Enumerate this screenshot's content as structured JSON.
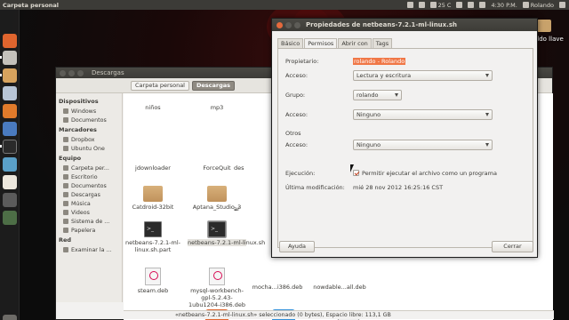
{
  "top_panel": {
    "window_title": "Carpeta personal",
    "temperature": "25 C",
    "clock": "4:30 P.M.",
    "user": "Rolando"
  },
  "desktop": {
    "folder_label": "aldo llave"
  },
  "file_manager": {
    "title": "Descargas",
    "path_buttons": [
      "Carpeta personal",
      "Descargas"
    ],
    "sidebar": {
      "devices_header": "Dispositivos",
      "devices": [
        "Windows",
        "Documentos"
      ],
      "bookmarks_header": "Marcadores",
      "bookmarks": [
        "Dropbox",
        "Ubuntu One"
      ],
      "computer_header": "Equipo",
      "computer": [
        "Carpeta per...",
        "Escritorio",
        "Documentos",
        "Descargas",
        "Música",
        "Videos",
        "Sistema de ...",
        "Papelera"
      ],
      "network_header": "Red",
      "network": [
        "Examinar la ..."
      ]
    },
    "files": [
      "niños",
      "mp3",
      "jdownloader",
      "ForceQuit",
      "des",
      "Catdroid-32bit",
      "Aptana_Studio_3",
      "ar",
      "netbeans-7.2.1-ml-linux.sh.part",
      "netbeans-7.2.1-ml-linux.sh",
      "steam.deb",
      "mysql-workbench-gpl-5.2.43-1ubu1204-i386.deb",
      "mocha...i386.deb",
      "nowdable...all.deb"
    ],
    "status": "«netbeans-7.2.1-ml-linux.sh» seleccionado (0 bytes), Espacio libre: 113,1 GB"
  },
  "dialog": {
    "title": "Propiedades de netbeans-7.2.1-ml-linux.sh",
    "tabs": [
      "Básico",
      "Permisos",
      "Abrir con",
      "Tags"
    ],
    "active_tab": "Permisos",
    "owner_label": "Propietario:",
    "owner_value": "rolando - Rolando",
    "owner_access_label": "Acceso:",
    "owner_access_value": "Lectura y escritura",
    "group_label": "Grupo:",
    "group_value": "rolando",
    "group_access_label": "Acceso:",
    "group_access_value": "Ninguno",
    "others_label": "Otros",
    "others_access_label": "Acceso:",
    "others_access_value": "Ninguno",
    "execution_label": "Ejecución:",
    "execution_checkbox_label": "Permitir ejecutar el archivo como un programa",
    "execution_checked": true,
    "modified_label": "Última modificación:",
    "modified_value": "mié 28 nov 2012 16:25:16 CST",
    "help_button": "Ayuda",
    "close_button": "Cerrar"
  },
  "colors": {
    "panel": "#3c3b37",
    "accent_orange": "#f07746",
    "folder": "#c8a26b"
  }
}
